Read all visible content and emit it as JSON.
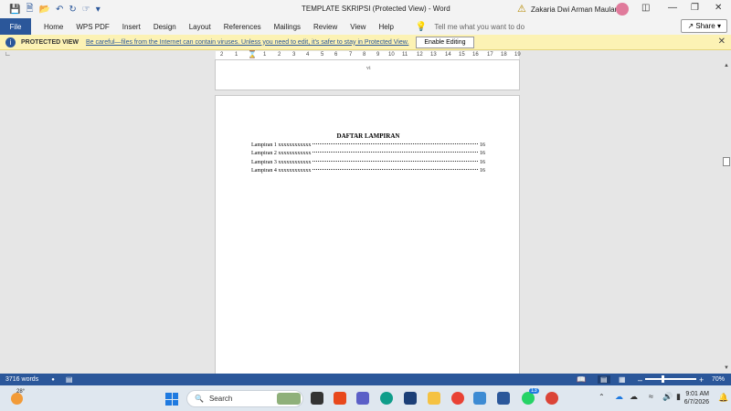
{
  "titlebar": {
    "doc_title": "TEMPLATE SKRIPSI (Protected View)  -  Word",
    "user_name": "Zakaria Dwi Arman Maulana"
  },
  "ribbon": {
    "file": "File",
    "tabs": [
      "Home",
      "WPS PDF",
      "Insert",
      "Design",
      "Layout",
      "References",
      "Mailings",
      "Review",
      "View",
      "Help"
    ],
    "tell_me": "Tell me what you want to do",
    "share": "Share"
  },
  "protected_view": {
    "title": "PROTECTED VIEW",
    "message": "Be careful—files from the Internet can contain viruses. Unless you need to edit, it's safer to stay in Protected View.",
    "enable_button": "Enable Editing"
  },
  "ruler": {
    "marks": [
      "2",
      "1",
      "1",
      "2",
      "3",
      "4",
      "5",
      "6",
      "7",
      "8",
      "9",
      "10",
      "11",
      "12",
      "13",
      "14",
      "15",
      "16",
      "17",
      "18",
      "19"
    ]
  },
  "document": {
    "prev_page_number": "vi",
    "heading": "DAFTAR LAMPIRAN",
    "entries": [
      {
        "label": "Lampiran 1 xxxxxxxxxxxx",
        "page": "16"
      },
      {
        "label": "Lampiran 2 xxxxxxxxxxxx",
        "page": "16"
      },
      {
        "label": "Lampiran 3 xxxxxxxxxxxx",
        "page": "16"
      },
      {
        "label": "Lampiran 4 xxxxxxxxxxxx",
        "page": "16"
      }
    ]
  },
  "statusbar": {
    "word_count": "3716 words",
    "zoom": "70%"
  },
  "taskbar": {
    "weather": "28°",
    "search": "Search",
    "whatsapp_badge": "13",
    "time": "9:01 AM",
    "date": "6/7/2026"
  }
}
